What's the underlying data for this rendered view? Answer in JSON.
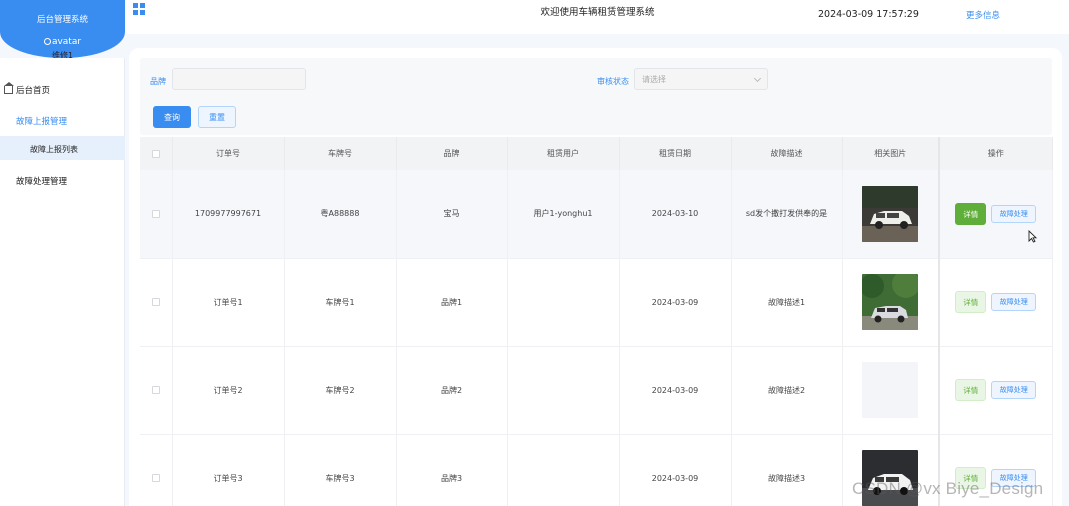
{
  "header": {
    "brand_title": "后台管理系统",
    "avatar_alt": "avatar",
    "user_name": "维修1",
    "welcome": "欢迎使用车辆租赁管理系统",
    "datetime": "2024-03-09 17:57:29",
    "more_info": "更多信息",
    "brand_color": "#3a8df0"
  },
  "sidebar": {
    "home": "后台首页",
    "group_report": "故障上报管理",
    "report_list": "故障上报列表",
    "group_handle": "故障处理管理"
  },
  "filters": {
    "brand_label": "品牌",
    "brand_value": "",
    "status_label": "审核状态",
    "status_placeholder": "请选择",
    "query": "查询",
    "reset": "重置"
  },
  "table": {
    "columns": [
      "订单号",
      "车牌号",
      "品牌",
      "租赁用户",
      "租赁日期",
      "故障描述",
      "相关图片",
      "操作"
    ],
    "detail_label": "详情",
    "fault_label": "故障处理",
    "rows": [
      {
        "order": "1709977997671",
        "plate": "粤A88888",
        "brand": "宝马",
        "user": "用户1-yonghu1",
        "date": "2024-03-10",
        "desc": "sd发个撒打发供奉的是",
        "image": "white-suv-night"
      },
      {
        "order": "订单号1",
        "plate": "车牌号1",
        "brand": "品牌1",
        "user": "",
        "date": "2024-03-09",
        "desc": "故障描述1",
        "image": "car-in-forest"
      },
      {
        "order": "订单号2",
        "plate": "车牌号2",
        "brand": "品牌2",
        "user": "",
        "date": "2024-03-09",
        "desc": "故障描述2",
        "image": "none"
      },
      {
        "order": "订单号3",
        "plate": "车牌号3",
        "brand": "品牌3",
        "user": "",
        "date": "2024-03-09",
        "desc": "故障描述3",
        "image": "white-suv-road"
      }
    ]
  },
  "watermark": "CSDN @vx Biye_Design"
}
